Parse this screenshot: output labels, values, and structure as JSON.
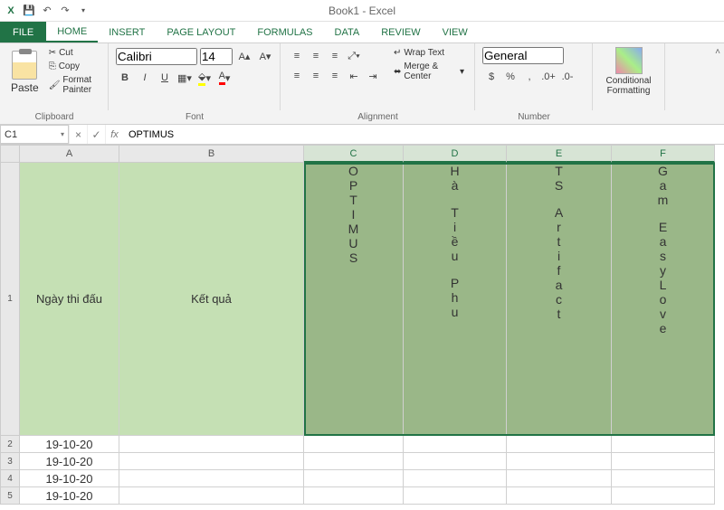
{
  "app": {
    "title": "Book1 - Excel"
  },
  "qat": {
    "save": "💾",
    "undo": "↶",
    "redo": "↷"
  },
  "tabs": [
    "FILE",
    "HOME",
    "INSERT",
    "PAGE LAYOUT",
    "FORMULAS",
    "DATA",
    "REVIEW",
    "VIEW"
  ],
  "active_tab": "HOME",
  "clipboard": {
    "cut": "Cut",
    "copy": "Copy",
    "fmtpainter": "Format Painter",
    "paste": "Paste",
    "label": "Clipboard"
  },
  "font": {
    "name": "Calibri",
    "size": "14",
    "label": "Font",
    "bold": "B",
    "italic": "I",
    "underline": "U"
  },
  "alignment": {
    "wrap": "Wrap Text",
    "merge": "Merge & Center",
    "label": "Alignment"
  },
  "number": {
    "format": "General",
    "label": "Number",
    "dollar": "$",
    "percent": "%",
    "comma": ","
  },
  "cond": {
    "label": "Conditional Formatting"
  },
  "formulabar": {
    "namebox": "C1",
    "value": "OPTIMUS"
  },
  "columns": [
    "A",
    "B",
    "C",
    "D",
    "E",
    "F"
  ],
  "selected_cols": [
    "C",
    "D",
    "E",
    "F"
  ],
  "row1": {
    "A": "Ngày thi đấu",
    "B": "Kết quả",
    "C": "OPTIMUS",
    "D": "Hà Tiều Phu",
    "E": "TS Artifact",
    "F": "Gam EasyLove"
  },
  "rows": [
    {
      "n": "2",
      "A": "19-10-20"
    },
    {
      "n": "3",
      "A": "19-10-20"
    },
    {
      "n": "4",
      "A": "19-10-20"
    },
    {
      "n": "5",
      "A": "19-10-20"
    }
  ]
}
